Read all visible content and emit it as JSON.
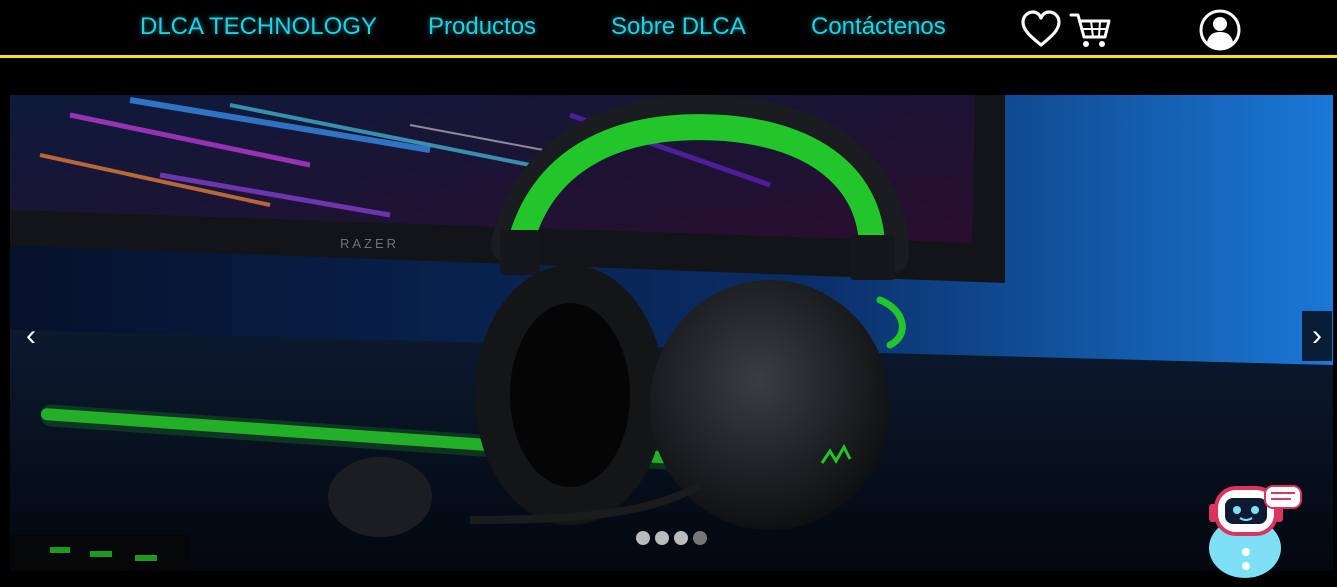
{
  "nav": {
    "brand": "DLCA TECHNOLOGY",
    "links": [
      "Productos",
      "Sobre DLCA",
      "Contáctenos"
    ],
    "icons": [
      "heart-icon",
      "cart-icon",
      "user-icon"
    ],
    "link_color": "#19d3e6",
    "border_color": "#f2e51b"
  },
  "carousel": {
    "slide": {
      "monitor_brand": "RAZER"
    },
    "prev_label": "‹",
    "next_label": "›",
    "dots": [
      {
        "active": false
      },
      {
        "active": false
      },
      {
        "active": false
      },
      {
        "active": true
      }
    ]
  },
  "chatbot": {
    "icon": "chatbot-icon"
  }
}
